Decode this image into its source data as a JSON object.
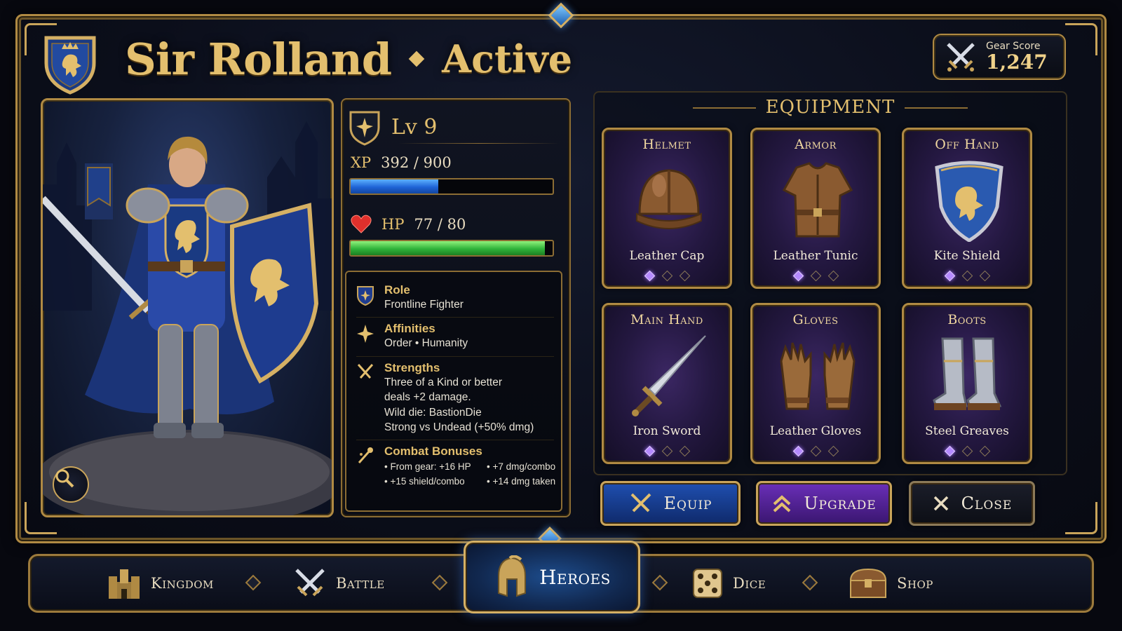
{
  "header": {
    "hero_name": "Sir Rolland",
    "status": "Active",
    "gear_score_label": "Gear Score",
    "gear_score_value": "1,247"
  },
  "stats": {
    "level_label": "Lv 9",
    "xp_label": "XP",
    "xp_value": "392 / 900",
    "xp_fraction": 0.4356,
    "hp_label": "HP",
    "hp_value": "77 / 80",
    "hp_fraction": 0.9625
  },
  "info": {
    "role_title": "Role",
    "role_value": "Frontline Fighter",
    "affinities_title": "Affinities",
    "affinities_value": "Order • Humanity",
    "strengths_title": "Strengths",
    "strengths_line1": "Three of a Kind or better",
    "strengths_line2": "deals +2 damage.",
    "strengths_line3": "Wild die: BastionDie",
    "strengths_line4": "Strong vs Undead (+50% dmg)",
    "combat_title": "Combat Bonuses",
    "bonus1": "• From gear: +16 HP",
    "bonus2": "• +7 dmg/combo",
    "bonus3": "• +15 shield/combo",
    "bonus4": "• +14 dmg taken"
  },
  "equipment": {
    "title": "EQUIPMENT",
    "slots": [
      {
        "slot": "Helmet",
        "item": "Leather Cap",
        "icon": "helmet-icon",
        "upgrades": 1
      },
      {
        "slot": "Armor",
        "item": "Leather Tunic",
        "icon": "tunic-icon",
        "upgrades": 1
      },
      {
        "slot": "Off Hand",
        "item": "Kite Shield",
        "icon": "shield-icon",
        "upgrades": 1
      },
      {
        "slot": "Main Hand",
        "item": "Iron Sword",
        "icon": "sword-icon",
        "upgrades": 1
      },
      {
        "slot": "Gloves",
        "item": "Leather Gloves",
        "icon": "gloves-icon",
        "upgrades": 1
      },
      {
        "slot": "Boots",
        "item": "Steel Greaves",
        "icon": "boots-icon",
        "upgrades": 1
      }
    ]
  },
  "actions": {
    "equip": "Equip",
    "upgrade": "Upgrade",
    "close": "Close"
  },
  "nav": {
    "kingdom": "Kingdom",
    "battle": "Battle",
    "heroes": "Heroes",
    "dice": "Dice",
    "shop": "Shop"
  },
  "colors": {
    "gold": "#b08a43",
    "xp_blue": "#1f63d6",
    "hp_green": "#2fb33a",
    "upgrade_purple": "#6a2fb8"
  }
}
